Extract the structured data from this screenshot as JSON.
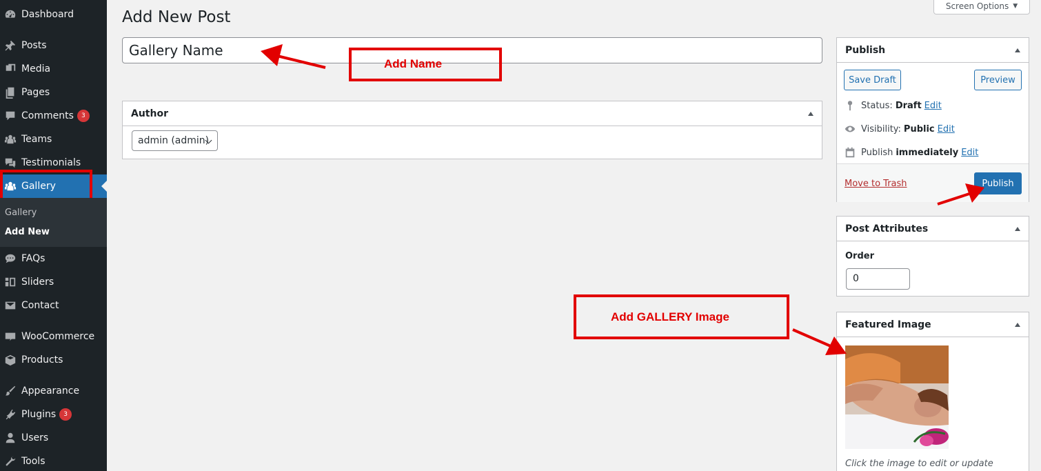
{
  "sidebar": {
    "items": [
      {
        "label": "Dashboard",
        "icon": "dashboard-icon"
      },
      {
        "label": "Posts",
        "icon": "pin-icon"
      },
      {
        "label": "Media",
        "icon": "media-icon"
      },
      {
        "label": "Pages",
        "icon": "pages-icon"
      },
      {
        "label": "Comments",
        "icon": "comment-icon",
        "badge": "3"
      },
      {
        "label": "Teams",
        "icon": "groups-icon"
      },
      {
        "label": "Testimonials",
        "icon": "testimonial-icon"
      },
      {
        "label": "Gallery",
        "icon": "groups-icon",
        "current": true
      },
      {
        "label": "FAQs",
        "icon": "faq-icon"
      },
      {
        "label": "Sliders",
        "icon": "slides-icon"
      },
      {
        "label": "Contact",
        "icon": "mail-icon"
      },
      {
        "label": "WooCommerce",
        "icon": "woo-icon"
      },
      {
        "label": "Products",
        "icon": "archive-icon"
      },
      {
        "label": "Appearance",
        "icon": "brush-icon"
      },
      {
        "label": "Plugins",
        "icon": "plugin-icon",
        "badge": "3"
      },
      {
        "label": "Users",
        "icon": "user-icon"
      },
      {
        "label": "Tools",
        "icon": "wrench-icon"
      }
    ],
    "submenu": [
      {
        "label": "Gallery"
      },
      {
        "label": "Add New",
        "active": true
      }
    ]
  },
  "header": {
    "title": "Add New Post",
    "screen_options": "Screen Options"
  },
  "title_input": {
    "value": "Gallery Name"
  },
  "author_box": {
    "title": "Author",
    "selected": "admin (admin)"
  },
  "publish_box": {
    "title": "Publish",
    "save_draft": "Save Draft",
    "preview": "Preview",
    "status_label": "Status:",
    "status_value": "Draft",
    "visibility_label": "Visibility:",
    "visibility_value": "Public",
    "publish_label": "Publish",
    "publish_value": "immediately",
    "edit": "Edit",
    "move_to_trash": "Move to Trash",
    "publish_button": "Publish"
  },
  "attributes_box": {
    "title": "Post Attributes",
    "order_label": "Order",
    "order_value": "0"
  },
  "featured_box": {
    "title": "Featured Image",
    "caption": "Click the image to edit or update"
  },
  "annotations": {
    "add_name": "Add Name",
    "add_gallery_image": "Add GALLERY Image",
    "color": "#e20000"
  },
  "colors": {
    "sidebar_bg": "#1d2327",
    "accent": "#2271b1"
  }
}
